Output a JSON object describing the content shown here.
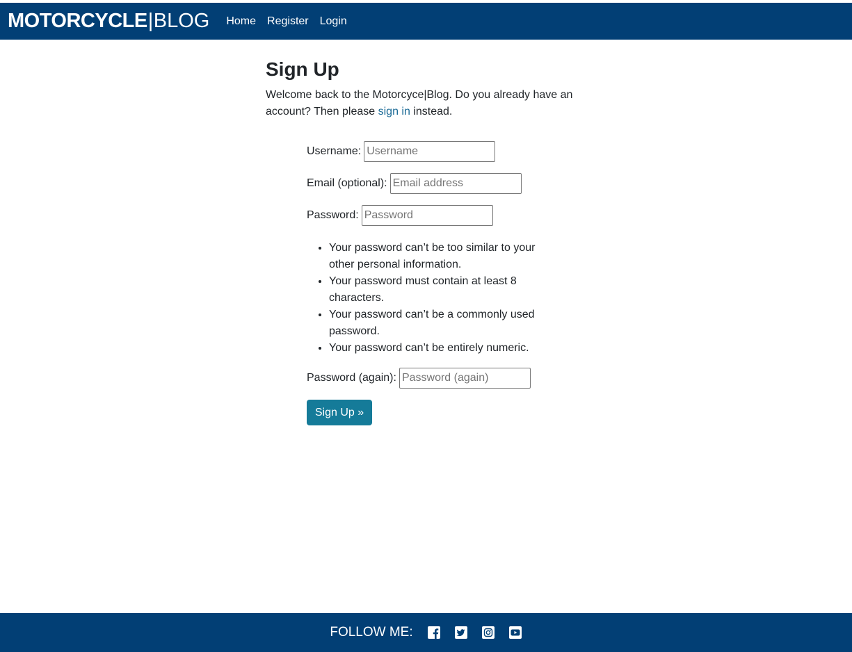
{
  "brand": {
    "bold": "MOTORCYCLE",
    "separator": "|",
    "light": "BLOG"
  },
  "nav": {
    "home": "Home",
    "register": "Register",
    "login": "Login"
  },
  "page": {
    "title": "Sign Up",
    "intro_before": "Welcome back to the Motorcyce|Blog. Do you already have an account? Then please ",
    "intro_link": "sign in",
    "intro_after": " instead."
  },
  "form": {
    "username": {
      "label": "Username:",
      "placeholder": "Username",
      "value": ""
    },
    "email": {
      "label": "Email (optional):",
      "placeholder": "Email address",
      "value": ""
    },
    "password": {
      "label": "Password:",
      "placeholder": "Password",
      "value": ""
    },
    "password_help": [
      "Your password can’t be too similar to your other personal information.",
      "Your password must contain at least 8 characters.",
      "Your password can’t be a commonly used password.",
      "Your password can’t be entirely numeric."
    ],
    "password_again": {
      "label": "Password (again):",
      "placeholder": "Password (again)",
      "value": ""
    },
    "submit_label": "Sign Up »"
  },
  "footer": {
    "follow_label": "FOLLOW ME:",
    "social_icons": [
      "facebook-icon",
      "twitter-icon",
      "instagram-icon",
      "youtube-icon"
    ]
  },
  "colors": {
    "navbar": "#023f75",
    "footer": "#023f75",
    "link": "#1a6a96",
    "button": "#157b99",
    "text": "#212529"
  }
}
